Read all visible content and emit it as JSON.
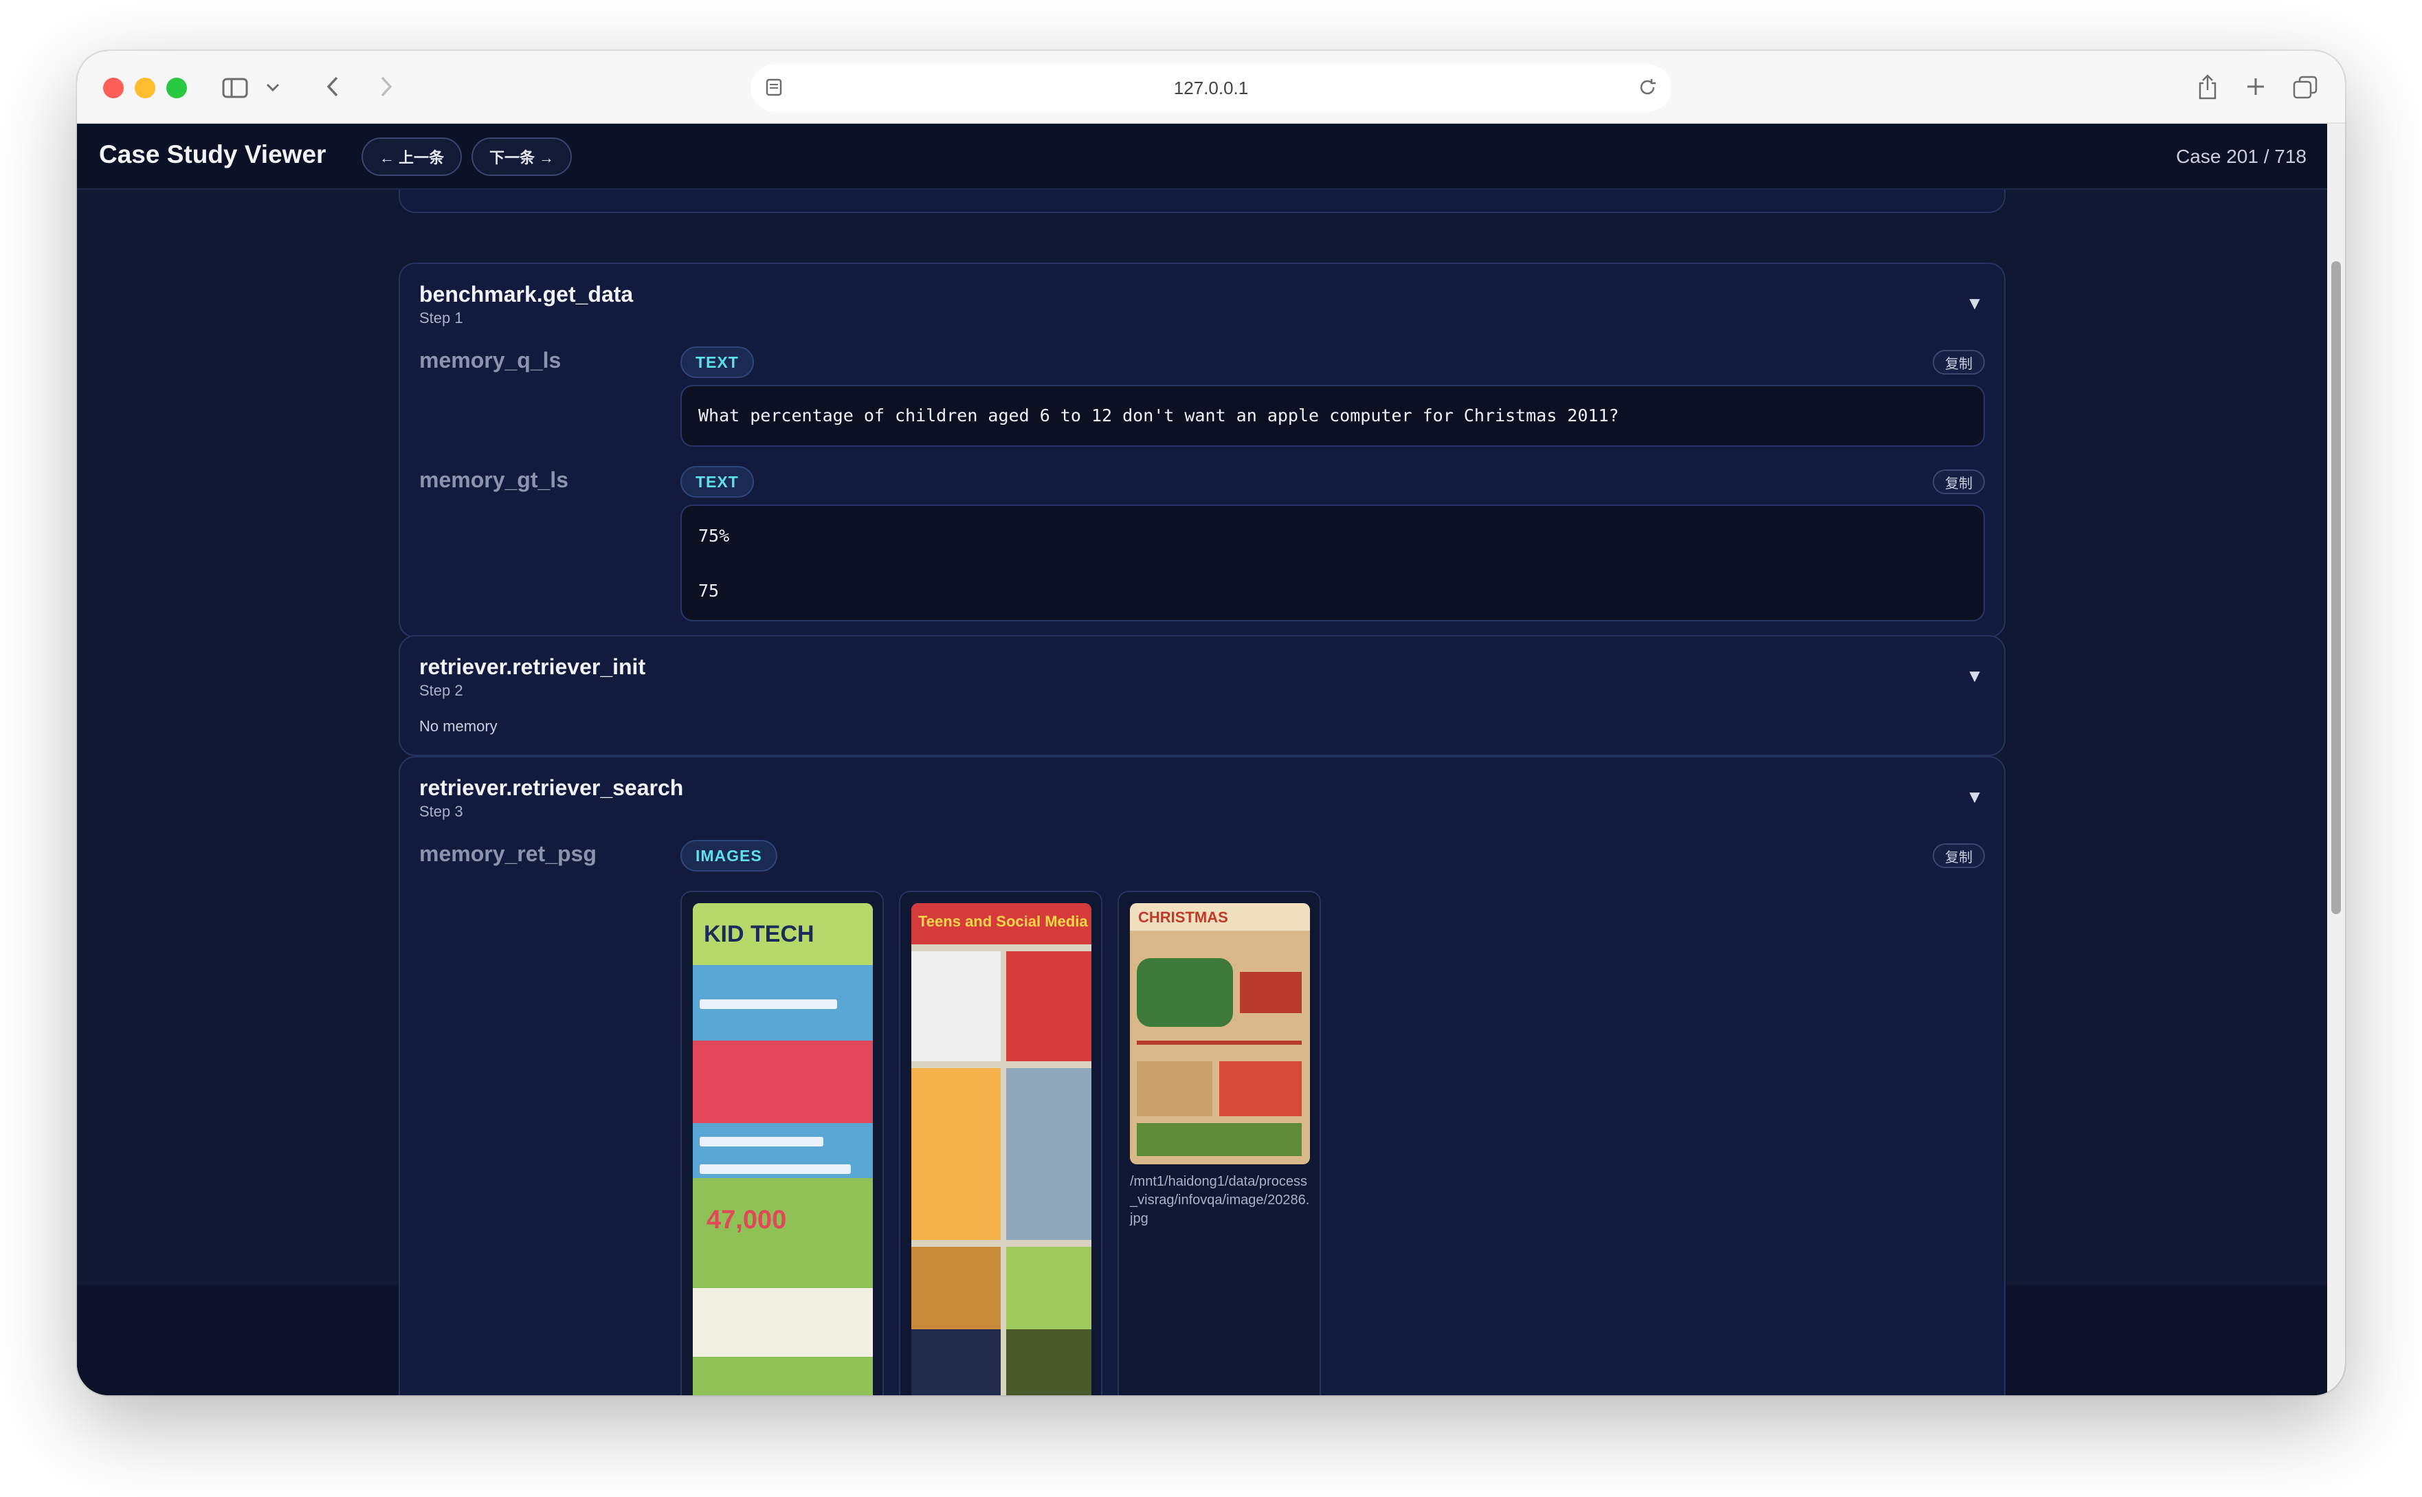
{
  "browser": {
    "address": "127.0.0.1"
  },
  "app": {
    "title": "Case Study Viewer",
    "prev_label": "← 上一条",
    "next_label": "下一条 →",
    "case_counter": "Case 201 / 718"
  },
  "cards": [
    {
      "title": "benchmark.get_data",
      "step": "Step 1",
      "fields": [
        {
          "label": "memory_q_ls",
          "type": "TEXT",
          "copy_label": "复制",
          "value": "What percentage of children aged 6 to 12 don't want an apple computer for Christmas 2011?"
        },
        {
          "label": "memory_gt_ls",
          "type": "TEXT",
          "copy_label": "复制",
          "values": [
            "75%",
            "75"
          ]
        }
      ]
    },
    {
      "title": "retriever.retriever_init",
      "step": "Step 2",
      "empty_text": "No memory"
    },
    {
      "title": "retriever.retriever_search",
      "step": "Step 3",
      "fields": [
        {
          "label": "memory_ret_psg",
          "type": "IMAGES",
          "copy_label": "复制",
          "images": [
            {
              "title": "KID TECH"
            },
            {
              "title": "Teens and Social Media"
            },
            {
              "title": "CHRISTMAS",
              "path": "/mnt1/haidong1/data/process_visrag/infovqa/image/20286.jpg"
            }
          ]
        }
      ]
    }
  ],
  "colors": {
    "background": "#0f1733",
    "card": "#121b3d",
    "badge_text": "#5ee0ea"
  },
  "icons": {
    "chevron": "▼"
  }
}
